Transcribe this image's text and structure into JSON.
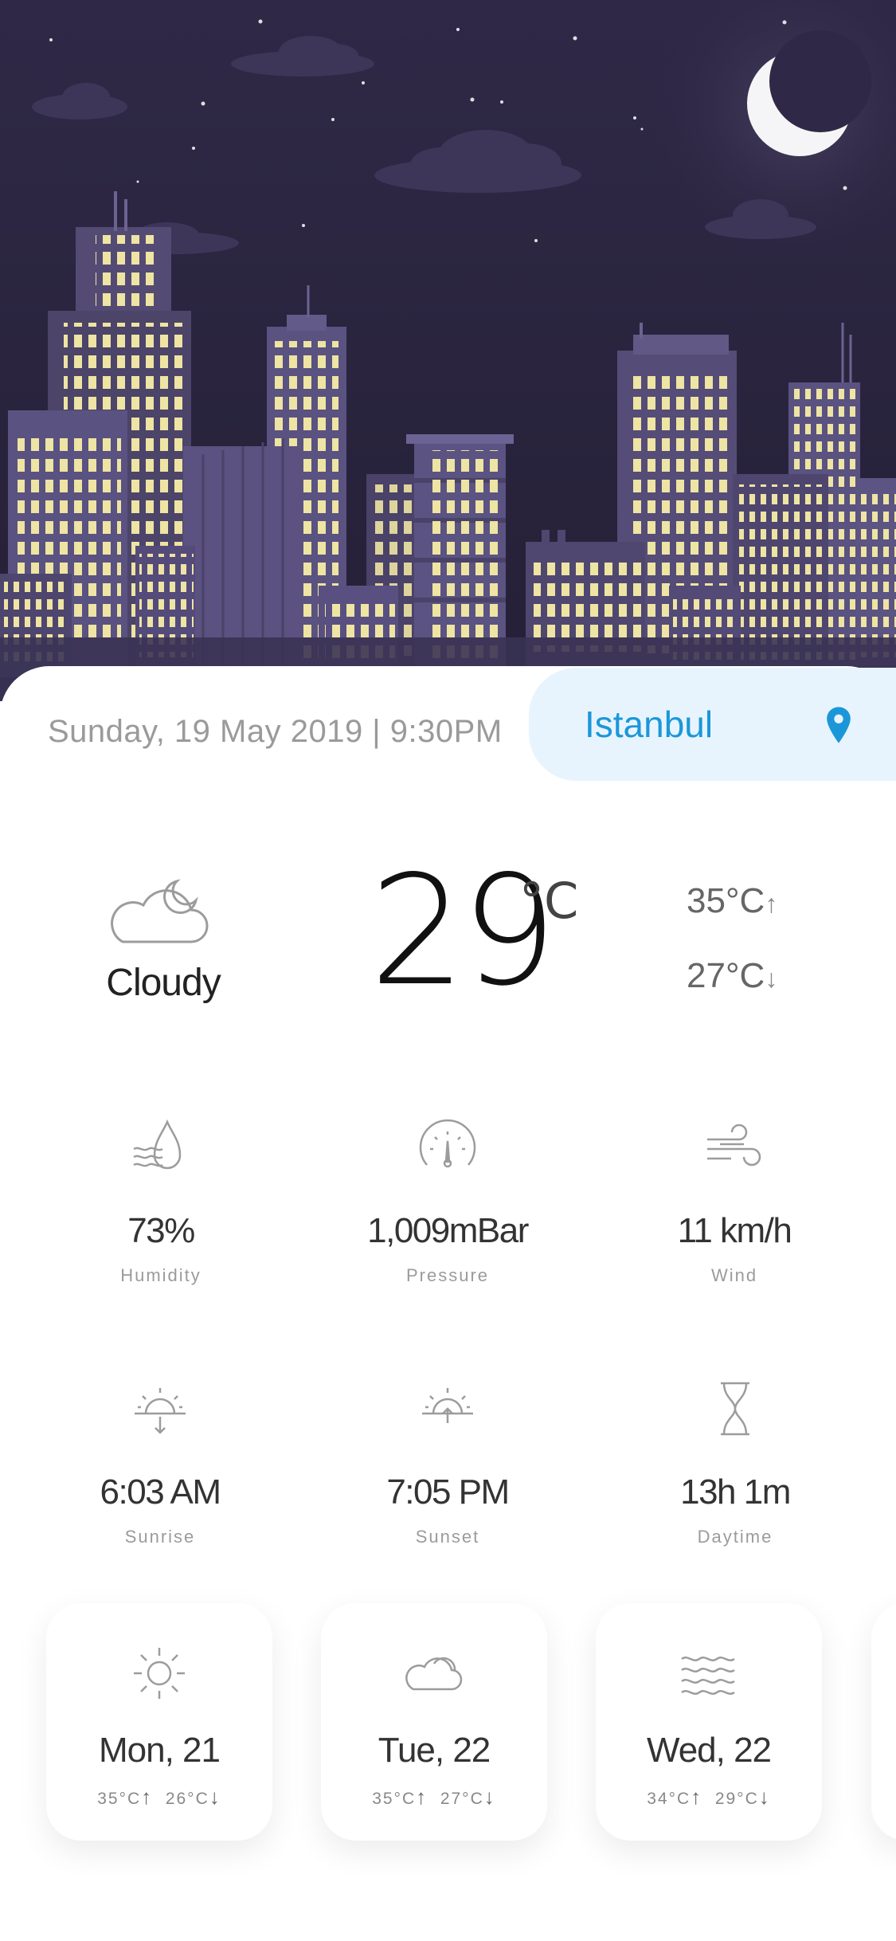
{
  "header": {
    "datetime": "Sunday, 19 May 2019 | 9:30PM",
    "city": "Istanbul",
    "icons": [
      "moon-icon",
      "location-pin-icon"
    ]
  },
  "current": {
    "condition": "Cloudy",
    "temperature": "29",
    "unit": "°C",
    "high": "35°C",
    "low": "27°C",
    "icons": [
      "cloud-moon-icon",
      "arrow-up-icon",
      "arrow-down-icon"
    ]
  },
  "stats": [
    {
      "value": "73%",
      "label": "Humidity",
      "icon": "humidity-icon"
    },
    {
      "value": "1,009mBar",
      "label": "Pressure",
      "icon": "pressure-gauge-icon"
    },
    {
      "value": "11 km/h",
      "label": "Wind",
      "icon": "wind-icon"
    },
    {
      "value": "6:03 AM",
      "label": "Sunrise",
      "icon": "sunrise-icon"
    },
    {
      "value": "7:05 PM",
      "label": "Sunset",
      "icon": "sunset-icon"
    },
    {
      "value": "13h 1m",
      "label": "Daytime",
      "icon": "hourglass-icon"
    }
  ],
  "forecast": [
    {
      "day": "Mon, 21",
      "high": "35°C",
      "low": "26°C",
      "icon": "sun-icon"
    },
    {
      "day": "Tue, 22",
      "high": "35°C",
      "low": "27°C",
      "icon": "cloud-icon"
    },
    {
      "day": "Wed, 22",
      "high": "34°C",
      "low": "29°C",
      "icon": "waves-icon"
    }
  ],
  "colors": {
    "sky": "#2c2743",
    "building": "#4f4770",
    "window": "#eee4a3",
    "accent": "#1b97d9",
    "pill": "#e8f4fd"
  }
}
